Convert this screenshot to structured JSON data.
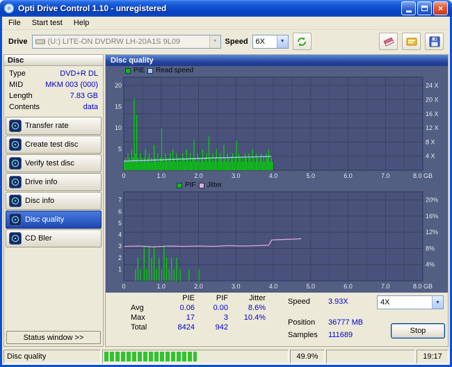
{
  "window": {
    "title": "Opti Drive Control 1.10 - unregistered"
  },
  "menu": {
    "items": [
      {
        "label": "File"
      },
      {
        "label": "Start test"
      },
      {
        "label": "Help"
      }
    ]
  },
  "toolbar": {
    "drive_label": "Drive",
    "drive_value": "(U:) LITE-ON DVDRW LH-20A1S 9L09",
    "speed_label": "Speed",
    "speed_value": "6X"
  },
  "disc_panel": {
    "title": "Disc",
    "rows": [
      {
        "label": "Type",
        "value": "DVD+R DL"
      },
      {
        "label": "MID",
        "value": "MKM 003 (000)"
      },
      {
        "label": "Length",
        "value": "7.83 GB"
      },
      {
        "label": "Contents",
        "value": "data"
      }
    ]
  },
  "sidebar": {
    "buttons": [
      {
        "label": "Transfer rate",
        "selected": false
      },
      {
        "label": "Create test disc",
        "selected": false
      },
      {
        "label": "Verify test disc",
        "selected": false
      },
      {
        "label": "Drive info",
        "selected": false
      },
      {
        "label": "Disc info",
        "selected": false
      },
      {
        "label": "Disc quality",
        "selected": true
      },
      {
        "label": "CD Bler",
        "selected": false
      }
    ],
    "status_window_label": "Status window >>"
  },
  "main": {
    "header": "Disc quality"
  },
  "chart_data": [
    {
      "type": "bar",
      "title": "PIE / Read speed",
      "legend": [
        {
          "label": "PIE",
          "color": "#00c400"
        },
        {
          "label": "Read speed",
          "color": "#9ecff8"
        }
      ],
      "x_range": [
        0,
        8
      ],
      "x_ticks": [
        {
          "v": 0,
          "label": "0"
        },
        {
          "v": 1,
          "label": "1.0"
        },
        {
          "v": 2,
          "label": "2.0"
        },
        {
          "v": 3,
          "label": "3.0"
        },
        {
          "v": 4,
          "label": "4.0"
        },
        {
          "v": 5,
          "label": "5.0"
        },
        {
          "v": 6,
          "label": "6.0"
        },
        {
          "v": 7,
          "label": "7.0"
        },
        {
          "v": 8,
          "label": "8.0 GB"
        }
      ],
      "left_axis": {
        "range": [
          0,
          22
        ],
        "values": [
          5,
          10,
          15,
          20
        ],
        "labels": [
          "5",
          "10",
          "15",
          "20"
        ]
      },
      "right_axis": {
        "range": [
          0,
          26.4
        ],
        "values": [
          4,
          8,
          12,
          16,
          20,
          24
        ],
        "labels": [
          "4 X",
          "8 X",
          "12 X",
          "16 X",
          "20 X",
          "24 X"
        ]
      },
      "bar_color": "#00d400",
      "bars_x_max": 4.0,
      "bars": [
        2,
        3,
        2,
        4,
        3,
        2,
        5,
        3,
        17,
        4,
        13,
        3,
        2,
        4,
        3,
        2,
        3,
        5,
        2,
        3,
        4,
        2,
        3,
        2,
        6,
        3,
        2,
        4,
        2,
        3,
        10,
        3,
        2,
        4,
        3,
        2,
        3,
        4,
        2,
        5,
        3,
        2,
        4,
        3,
        2,
        3,
        2,
        4,
        3,
        2,
        5,
        3,
        2,
        4,
        2,
        3,
        7,
        3,
        2,
        4,
        3,
        2,
        3,
        5,
        2,
        3,
        4,
        2,
        8,
        3,
        2,
        4,
        2,
        3,
        5,
        2,
        3,
        4,
        3,
        2,
        6,
        3,
        2,
        4,
        3,
        2,
        3,
        4,
        2,
        3,
        7,
        2,
        4,
        3,
        2,
        3,
        2,
        4,
        3,
        2,
        4,
        3,
        2,
        5,
        3,
        2,
        4,
        3,
        2,
        3,
        4,
        2,
        3,
        2,
        4,
        3,
        5,
        2,
        3,
        2
      ],
      "line": {
        "color": "#aacdf2",
        "points": [
          [
            0,
            2.6
          ],
          [
            0.8,
            2.9
          ],
          [
            1.6,
            3.2
          ],
          [
            2.4,
            3.5
          ],
          [
            3.2,
            3.75
          ],
          [
            3.95,
            3.93
          ]
        ]
      }
    },
    {
      "type": "bar",
      "title": "PIF / Jitter",
      "legend": [
        {
          "label": "PIF",
          "color": "#00c400"
        },
        {
          "label": "Jitter",
          "color": "#e2aee2"
        }
      ],
      "x_range": [
        0,
        8
      ],
      "x_ticks": [
        {
          "v": 0,
          "label": "0"
        },
        {
          "v": 1,
          "label": "1.0"
        },
        {
          "v": 2,
          "label": "2.0"
        },
        {
          "v": 3,
          "label": "3.0"
        },
        {
          "v": 4,
          "label": "4.0"
        },
        {
          "v": 5,
          "label": "5.0"
        },
        {
          "v": 6,
          "label": "6.0"
        },
        {
          "v": 7,
          "label": "7.0"
        },
        {
          "v": 8,
          "label": "8.0 GB"
        }
      ],
      "left_axis": {
        "range": [
          0,
          7.7
        ],
        "values": [
          1,
          2,
          3,
          4,
          5,
          6,
          7
        ],
        "labels": [
          "1",
          "2",
          "3",
          "4",
          "5",
          "6",
          "7"
        ]
      },
      "right_axis": {
        "range": [
          0,
          22
        ],
        "values": [
          4,
          8,
          12,
          16,
          20
        ],
        "labels": [
          "4%",
          "8%",
          "12%",
          "16%",
          "20%"
        ]
      },
      "bar_color": "#00d400",
      "bars_x_max": 4.0,
      "bars": [
        0,
        0,
        0,
        0,
        0,
        0,
        0,
        0,
        0,
        1,
        0,
        2,
        0,
        1,
        0,
        0,
        3,
        0,
        1,
        0,
        3,
        0,
        2,
        0,
        3,
        0,
        1,
        0,
        2,
        0,
        1,
        0,
        3,
        0,
        2,
        0,
        1,
        0,
        2,
        0,
        1,
        0,
        2,
        0,
        0,
        1,
        0,
        0,
        0,
        0,
        0,
        0,
        1,
        0,
        0,
        0,
        0,
        0,
        0,
        0,
        1,
        0,
        0,
        0,
        0,
        0,
        0,
        0,
        0,
        0,
        0,
        0,
        0,
        0,
        0,
        0,
        0,
        0,
        0,
        0,
        0,
        0,
        0,
        0,
        0,
        0,
        0,
        0,
        0,
        0,
        0,
        0,
        0,
        0,
        0,
        0,
        0,
        0,
        0,
        0,
        0,
        0,
        0,
        0,
        0,
        0,
        0,
        0,
        0,
        0,
        0,
        0,
        0,
        0,
        0,
        0,
        0,
        0,
        0,
        0
      ],
      "line": {
        "color": "#dfa8df",
        "points": [
          [
            0.02,
            8.5
          ],
          [
            0.4,
            8.6
          ],
          [
            0.8,
            8.4
          ],
          [
            1.2,
            8.6
          ],
          [
            1.6,
            8.5
          ],
          [
            2.0,
            8.6
          ],
          [
            2.4,
            8.5
          ],
          [
            2.8,
            8.7
          ],
          [
            3.2,
            8.6
          ],
          [
            3.6,
            8.7
          ],
          [
            3.88,
            8.8
          ],
          [
            3.96,
            10.1
          ],
          [
            4.2,
            10.2
          ],
          [
            4.5,
            10.3
          ],
          [
            4.75,
            10.4
          ]
        ]
      }
    }
  ],
  "stats": {
    "columns": [
      "PIE",
      "PIF",
      "Jitter"
    ],
    "rows": [
      {
        "label": "Avg",
        "values": [
          "0.06",
          "0.00",
          "8.6%"
        ]
      },
      {
        "label": "Max",
        "values": [
          "17",
          "3",
          "10.4%"
        ]
      },
      {
        "label": "Total",
        "values": [
          "8424",
          "942",
          ""
        ]
      }
    ],
    "speed_label": "Speed",
    "speed_value": "3.93X",
    "position_label": "Position",
    "position_value": "36777 MB",
    "samples_label": "Samples",
    "samples_value": "111689",
    "speed_select": "4X",
    "stop_label": "Stop"
  },
  "statusbar": {
    "left": "Disc quality",
    "progress_percent": 49.9,
    "progress_text": "49.9%",
    "time": "19:17"
  }
}
